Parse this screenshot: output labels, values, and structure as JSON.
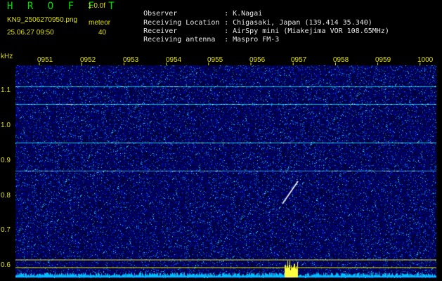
{
  "header": {
    "app_title": "H R O F F T",
    "version": "1.0.0f",
    "filename": "KN9_2506270950.png",
    "datetime": "25.06.27 09:50",
    "meteor_label": "meteor",
    "meteor_count": "40"
  },
  "info": [
    {
      "key": "Observer",
      "sep": ":",
      "value": "K.Nagai"
    },
    {
      "key": "Receiving Location",
      "sep": ":",
      "value": "Chigasaki, Japan (139.414 35.340)"
    },
    {
      "key": "Receiver",
      "sep": ":",
      "value": "AirSpy mini (Miakejima VOR 108.65MHz)"
    },
    {
      "key": "Receiving antenna",
      "sep": ":",
      "value": "Maspro FM-3"
    }
  ],
  "axis": {
    "y_unit": "kHz",
    "y_ticks": [
      "1.1",
      "1.0",
      "0.9",
      "0.8",
      "0.7",
      "0.6"
    ],
    "x_ticks": [
      "0951",
      "0952",
      "0953",
      "0954",
      "0955",
      "0956",
      "0957",
      "0958",
      "0959",
      "1000"
    ]
  },
  "colors": {
    "background": "#000000",
    "noise_base": "#0a0a6a",
    "carrier": "#00e0f0",
    "label": "#e0e000",
    "meteor": "#ffffff",
    "spectrum": "#00c0ff"
  },
  "carrier_lines_khz": [
    1.115,
    1.065,
    0.955,
    0.875
  ],
  "meteor_echo": {
    "time_start": "0957",
    "time_end": "0957",
    "freq_start_khz": 0.78,
    "freq_end_khz": 0.83
  }
}
